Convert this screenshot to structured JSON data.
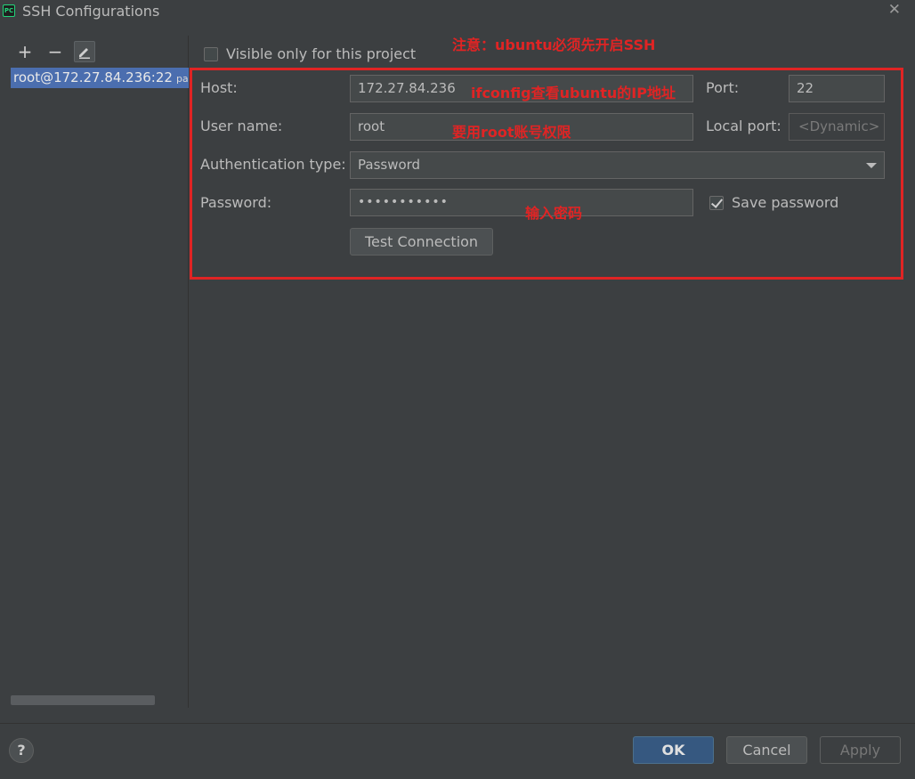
{
  "window": {
    "title": "SSH Configurations",
    "app_icon_text": "PC"
  },
  "toolbar": {
    "add": "+",
    "remove": "−"
  },
  "config_list": [
    {
      "label": "root@172.27.84.236:22",
      "suffix": "pas"
    }
  ],
  "form": {
    "visible_only_label": "Visible only for this project",
    "visible_only_checked": false,
    "host_label": "Host:",
    "host_value": "172.27.84.236",
    "port_label": "Port:",
    "port_value": "22",
    "user_label": "User name:",
    "user_value": "root",
    "local_port_label": "Local port:",
    "local_port_placeholder": "<Dynamic>",
    "auth_label": "Authentication type:",
    "auth_value": "Password",
    "password_label": "Password:",
    "password_value": "•••••••••••",
    "save_password_label": "Save password",
    "save_password_checked": true,
    "test_connection": "Test Connection"
  },
  "annotations": {
    "top_note": "注意：ubuntu必须先开启SSH",
    "host_note": "ifconfig查看ubuntu的IP地址",
    "user_note": "要用root账号权限",
    "password_note": "输入密码",
    "color": "#e02424"
  },
  "footer": {
    "help": "?",
    "ok": "OK",
    "cancel": "Cancel",
    "apply": "Apply"
  },
  "colors": {
    "background": "#3c3f41",
    "selection": "#4b6eaf",
    "primary_button": "#365880"
  }
}
